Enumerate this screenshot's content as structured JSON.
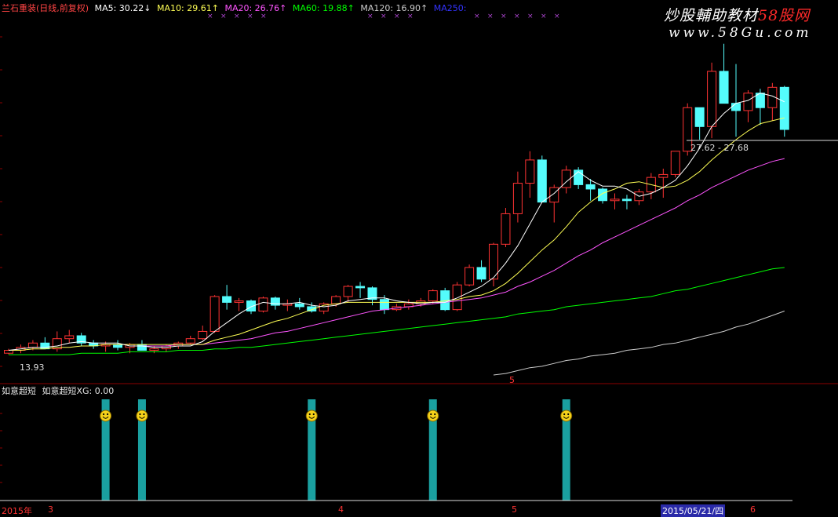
{
  "header": {
    "stock": "兰石重装(日线,前复权)",
    "ma5": "MA5: 30.22↓",
    "ma10": "MA10: 29.61↑",
    "ma20": "MA20: 26.76↑",
    "ma60": "MA60: 19.88↑",
    "ma120": "MA120: 16.90↑",
    "ma250": "MA250:"
  },
  "watermark": {
    "line1_a": "炒股輔助教材",
    "line1_b": "58股网",
    "line2": "www.58Gu.com"
  },
  "price_labels": {
    "low": "13.93",
    "range": "27.62 - 27.68",
    "marker": "5"
  },
  "sub_header": {
    "title": "如意超短",
    "value": "如意超短XG: 0.00"
  },
  "x_axis": {
    "year": "2015年",
    "m3": "3",
    "m4": "4",
    "m5": "5",
    "cursor_date": "2015/05/21/四",
    "m6": "6"
  },
  "colors": {
    "up": "#ff3333",
    "down": "#54fcfc",
    "ma5": "#ffffff",
    "ma10": "#ffff55",
    "ma20": "#ff55ff",
    "ma60": "#00ff00",
    "ma120": "#cccccc",
    "ma250": "#3333ff",
    "grid": "#8b0000",
    "signal": "#1aa0a0"
  },
  "chart_data": [
    {
      "type": "candlestick",
      "title": "兰石重装(日线,前复权)",
      "ylim": [
        12.5,
        37.5
      ],
      "candles": [
        [
          14.0,
          14.3,
          13.93,
          14.2
        ],
        [
          14.2,
          14.6,
          14.0,
          14.4
        ],
        [
          14.4,
          14.9,
          14.2,
          14.7
        ],
        [
          14.7,
          15.1,
          14.5,
          14.3
        ],
        [
          14.3,
          15.5,
          14.1,
          15.0
        ],
        [
          15.0,
          15.6,
          14.7,
          15.2
        ],
        [
          15.2,
          15.4,
          14.5,
          14.7
        ],
        [
          14.7,
          14.9,
          14.3,
          14.5
        ],
        [
          14.5,
          14.8,
          14.1,
          14.6
        ],
        [
          14.6,
          14.9,
          14.2,
          14.4
        ],
        [
          14.4,
          14.7,
          14.0,
          14.6
        ],
        [
          14.6,
          14.9,
          14.3,
          14.2
        ],
        [
          14.2,
          14.5,
          14.0,
          14.3
        ],
        [
          14.3,
          14.6,
          14.1,
          14.5
        ],
        [
          14.5,
          14.8,
          14.3,
          14.7
        ],
        [
          14.7,
          15.2,
          14.6,
          15.0
        ],
        [
          15.0,
          15.9,
          14.9,
          15.5
        ],
        [
          15.5,
          18.0,
          15.4,
          17.9
        ],
        [
          17.9,
          18.7,
          17.0,
          17.5
        ],
        [
          17.5,
          17.8,
          16.9,
          17.6
        ],
        [
          17.6,
          17.7,
          16.7,
          16.9
        ],
        [
          16.9,
          17.9,
          16.8,
          17.8
        ],
        [
          17.8,
          17.9,
          17.0,
          17.3
        ],
        [
          17.3,
          17.7,
          16.9,
          17.4
        ],
        [
          17.4,
          17.8,
          17.0,
          17.2
        ],
        [
          17.2,
          17.5,
          16.8,
          16.9
        ],
        [
          16.9,
          17.5,
          16.7,
          17.4
        ],
        [
          17.4,
          18.0,
          17.2,
          17.9
        ],
        [
          17.9,
          18.7,
          17.5,
          18.6
        ],
        [
          18.6,
          18.9,
          17.8,
          18.5
        ],
        [
          18.5,
          18.6,
          17.3,
          17.7
        ],
        [
          17.7,
          18.0,
          16.7,
          17.0
        ],
        [
          17.0,
          17.4,
          16.9,
          17.2
        ],
        [
          17.2,
          17.7,
          17.0,
          17.4
        ],
        [
          17.4,
          17.8,
          17.2,
          17.6
        ],
        [
          17.6,
          18.4,
          17.4,
          18.3
        ],
        [
          18.3,
          18.5,
          16.9,
          17.0
        ],
        [
          17.0,
          18.9,
          16.9,
          18.7
        ],
        [
          18.7,
          20.1,
          18.6,
          19.9
        ],
        [
          19.9,
          20.4,
          18.9,
          19.1
        ],
        [
          19.1,
          21.6,
          18.6,
          21.5
        ],
        [
          21.5,
          24.0,
          21.3,
          23.6
        ],
        [
          23.6,
          26.5,
          23.0,
          25.7
        ],
        [
          25.7,
          27.9,
          24.7,
          27.3
        ],
        [
          27.3,
          27.6,
          24.5,
          24.4
        ],
        [
          24.4,
          25.6,
          23.0,
          25.4
        ],
        [
          25.4,
          26.9,
          25.0,
          26.6
        ],
        [
          26.6,
          26.8,
          25.3,
          25.6
        ],
        [
          25.6,
          26.0,
          24.5,
          25.3
        ],
        [
          25.3,
          25.4,
          24.3,
          24.5
        ],
        [
          24.5,
          25.0,
          23.9,
          24.6
        ],
        [
          24.6,
          24.9,
          23.9,
          24.5
        ],
        [
          24.5,
          25.3,
          24.2,
          25.1
        ],
        [
          25.1,
          26.4,
          24.6,
          26.1
        ],
        [
          26.1,
          26.7,
          24.7,
          26.3
        ],
        [
          26.3,
          27.9,
          26.1,
          27.9
        ],
        [
          27.9,
          31.2,
          27.6,
          30.9
        ],
        [
          30.9,
          30.9,
          28.7,
          29.6
        ],
        [
          29.6,
          34.0,
          28.8,
          33.4
        ],
        [
          33.4,
          35.3,
          31.5,
          31.2
        ],
        [
          31.2,
          33.9,
          28.9,
          30.7
        ],
        [
          30.7,
          32.1,
          29.9,
          31.9
        ],
        [
          31.9,
          32.2,
          29.7,
          30.9
        ],
        [
          30.9,
          32.6,
          30.0,
          32.3
        ],
        [
          32.3,
          32.4,
          28.9,
          29.4
        ]
      ],
      "ma5": [
        14.2,
        14.3,
        14.4,
        14.4,
        14.5,
        14.7,
        14.8,
        14.7,
        14.7,
        14.7,
        14.5,
        14.5,
        14.4,
        14.4,
        14.5,
        14.5,
        14.8,
        15.5,
        16.1,
        16.7,
        17.2,
        17.5,
        17.4,
        17.4,
        17.5,
        17.3,
        17.2,
        17.3,
        17.6,
        17.7,
        17.8,
        17.8,
        17.6,
        17.5,
        17.4,
        17.5,
        17.5,
        17.8,
        18.2,
        18.6,
        19.2,
        20.2,
        21.4,
        22.9,
        24.4,
        25.0,
        25.8,
        26.5,
        25.9,
        25.5,
        25.5,
        25.3,
        24.8,
        25.0,
        25.4,
        25.9,
        26.9,
        28.1,
        29.6,
        30.5,
        31.2,
        31.4,
        31.9,
        31.7,
        31.3
      ],
      "ma10": [
        14.2,
        14.2,
        14.3,
        14.3,
        14.4,
        14.4,
        14.5,
        14.5,
        14.6,
        14.6,
        14.6,
        14.6,
        14.6,
        14.6,
        14.6,
        14.6,
        14.6,
        14.9,
        15.1,
        15.3,
        15.6,
        15.9,
        16.2,
        16.4,
        16.7,
        17.0,
        17.3,
        17.4,
        17.5,
        17.5,
        17.5,
        17.5,
        17.5,
        17.5,
        17.5,
        17.5,
        17.6,
        17.7,
        17.9,
        18.0,
        18.3,
        18.8,
        19.5,
        20.3,
        21.1,
        21.8,
        22.7,
        23.7,
        24.4,
        25.0,
        25.3,
        25.7,
        25.8,
        25.6,
        25.4,
        25.5,
        25.9,
        26.5,
        27.3,
        28.0,
        28.7,
        29.3,
        29.8,
        30.0,
        30.2
      ],
      "ma20": [
        null,
        null,
        null,
        null,
        null,
        null,
        null,
        null,
        null,
        null,
        14.5,
        14.5,
        14.5,
        14.5,
        14.6,
        14.6,
        14.6,
        14.7,
        14.8,
        14.9,
        15.0,
        15.2,
        15.4,
        15.5,
        15.7,
        15.9,
        16.1,
        16.3,
        16.5,
        16.7,
        16.9,
        17.0,
        17.1,
        17.2,
        17.3,
        17.4,
        17.5,
        17.6,
        17.7,
        17.8,
        18.0,
        18.2,
        18.6,
        18.9,
        19.3,
        19.7,
        20.2,
        20.7,
        21.1,
        21.6,
        22.0,
        22.4,
        22.8,
        23.2,
        23.6,
        24.0,
        24.5,
        24.9,
        25.4,
        25.8,
        26.2,
        26.6,
        26.9,
        27.2,
        27.4
      ],
      "ma60": [
        13.9,
        13.9,
        13.9,
        13.9,
        13.9,
        13.9,
        14.0,
        14.0,
        14.0,
        14.0,
        14.1,
        14.1,
        14.1,
        14.1,
        14.2,
        14.2,
        14.2,
        14.3,
        14.3,
        14.4,
        14.4,
        14.5,
        14.6,
        14.7,
        14.8,
        14.9,
        15.0,
        15.1,
        15.2,
        15.3,
        15.4,
        15.5,
        15.6,
        15.7,
        15.8,
        15.9,
        16.0,
        16.1,
        16.2,
        16.3,
        16.4,
        16.5,
        16.7,
        16.8,
        16.9,
        17.0,
        17.2,
        17.3,
        17.4,
        17.5,
        17.6,
        17.7,
        17.8,
        17.9,
        18.1,
        18.3,
        18.4,
        18.6,
        18.8,
        19.0,
        19.2,
        19.4,
        19.6,
        19.8,
        19.9
      ],
      "ma120": [
        null,
        null,
        null,
        null,
        null,
        null,
        null,
        null,
        null,
        null,
        null,
        null,
        null,
        null,
        null,
        null,
        null,
        null,
        null,
        null,
        null,
        null,
        null,
        null,
        null,
        null,
        null,
        null,
        null,
        null,
        null,
        null,
        null,
        null,
        null,
        null,
        null,
        null,
        null,
        null,
        12.5,
        12.6,
        12.8,
        13.0,
        13.1,
        13.3,
        13.5,
        13.6,
        13.8,
        13.9,
        14.0,
        14.2,
        14.3,
        14.4,
        14.6,
        14.7,
        14.9,
        15.1,
        15.3,
        15.5,
        15.8,
        16.0,
        16.3,
        16.6,
        16.9
      ]
    },
    {
      "type": "bar",
      "title": "如意超短",
      "series": [
        {
          "values_at_index": [
            8,
            11,
            25,
            35,
            46
          ]
        }
      ],
      "ylim": [
        0,
        1
      ]
    }
  ]
}
